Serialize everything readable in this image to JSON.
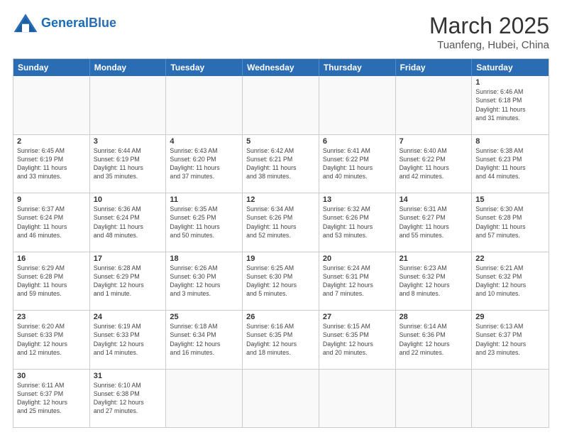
{
  "header": {
    "logo_general": "General",
    "logo_blue": "Blue",
    "month": "March 2025",
    "location": "Tuanfeng, Hubei, China"
  },
  "weekdays": [
    "Sunday",
    "Monday",
    "Tuesday",
    "Wednesday",
    "Thursday",
    "Friday",
    "Saturday"
  ],
  "rows": [
    [
      {
        "day": "",
        "info": ""
      },
      {
        "day": "",
        "info": ""
      },
      {
        "day": "",
        "info": ""
      },
      {
        "day": "",
        "info": ""
      },
      {
        "day": "",
        "info": ""
      },
      {
        "day": "",
        "info": ""
      },
      {
        "day": "1",
        "info": "Sunrise: 6:46 AM\nSunset: 6:18 PM\nDaylight: 11 hours\nand 31 minutes."
      }
    ],
    [
      {
        "day": "2",
        "info": "Sunrise: 6:45 AM\nSunset: 6:19 PM\nDaylight: 11 hours\nand 33 minutes."
      },
      {
        "day": "3",
        "info": "Sunrise: 6:44 AM\nSunset: 6:19 PM\nDaylight: 11 hours\nand 35 minutes."
      },
      {
        "day": "4",
        "info": "Sunrise: 6:43 AM\nSunset: 6:20 PM\nDaylight: 11 hours\nand 37 minutes."
      },
      {
        "day": "5",
        "info": "Sunrise: 6:42 AM\nSunset: 6:21 PM\nDaylight: 11 hours\nand 38 minutes."
      },
      {
        "day": "6",
        "info": "Sunrise: 6:41 AM\nSunset: 6:22 PM\nDaylight: 11 hours\nand 40 minutes."
      },
      {
        "day": "7",
        "info": "Sunrise: 6:40 AM\nSunset: 6:22 PM\nDaylight: 11 hours\nand 42 minutes."
      },
      {
        "day": "8",
        "info": "Sunrise: 6:38 AM\nSunset: 6:23 PM\nDaylight: 11 hours\nand 44 minutes."
      }
    ],
    [
      {
        "day": "9",
        "info": "Sunrise: 6:37 AM\nSunset: 6:24 PM\nDaylight: 11 hours\nand 46 minutes."
      },
      {
        "day": "10",
        "info": "Sunrise: 6:36 AM\nSunset: 6:24 PM\nDaylight: 11 hours\nand 48 minutes."
      },
      {
        "day": "11",
        "info": "Sunrise: 6:35 AM\nSunset: 6:25 PM\nDaylight: 11 hours\nand 50 minutes."
      },
      {
        "day": "12",
        "info": "Sunrise: 6:34 AM\nSunset: 6:26 PM\nDaylight: 11 hours\nand 52 minutes."
      },
      {
        "day": "13",
        "info": "Sunrise: 6:32 AM\nSunset: 6:26 PM\nDaylight: 11 hours\nand 53 minutes."
      },
      {
        "day": "14",
        "info": "Sunrise: 6:31 AM\nSunset: 6:27 PM\nDaylight: 11 hours\nand 55 minutes."
      },
      {
        "day": "15",
        "info": "Sunrise: 6:30 AM\nSunset: 6:28 PM\nDaylight: 11 hours\nand 57 minutes."
      }
    ],
    [
      {
        "day": "16",
        "info": "Sunrise: 6:29 AM\nSunset: 6:28 PM\nDaylight: 11 hours\nand 59 minutes."
      },
      {
        "day": "17",
        "info": "Sunrise: 6:28 AM\nSunset: 6:29 PM\nDaylight: 12 hours\nand 1 minute."
      },
      {
        "day": "18",
        "info": "Sunrise: 6:26 AM\nSunset: 6:30 PM\nDaylight: 12 hours\nand 3 minutes."
      },
      {
        "day": "19",
        "info": "Sunrise: 6:25 AM\nSunset: 6:30 PM\nDaylight: 12 hours\nand 5 minutes."
      },
      {
        "day": "20",
        "info": "Sunrise: 6:24 AM\nSunset: 6:31 PM\nDaylight: 12 hours\nand 7 minutes."
      },
      {
        "day": "21",
        "info": "Sunrise: 6:23 AM\nSunset: 6:32 PM\nDaylight: 12 hours\nand 8 minutes."
      },
      {
        "day": "22",
        "info": "Sunrise: 6:21 AM\nSunset: 6:32 PM\nDaylight: 12 hours\nand 10 minutes."
      }
    ],
    [
      {
        "day": "23",
        "info": "Sunrise: 6:20 AM\nSunset: 6:33 PM\nDaylight: 12 hours\nand 12 minutes."
      },
      {
        "day": "24",
        "info": "Sunrise: 6:19 AM\nSunset: 6:33 PM\nDaylight: 12 hours\nand 14 minutes."
      },
      {
        "day": "25",
        "info": "Sunrise: 6:18 AM\nSunset: 6:34 PM\nDaylight: 12 hours\nand 16 minutes."
      },
      {
        "day": "26",
        "info": "Sunrise: 6:16 AM\nSunset: 6:35 PM\nDaylight: 12 hours\nand 18 minutes."
      },
      {
        "day": "27",
        "info": "Sunrise: 6:15 AM\nSunset: 6:35 PM\nDaylight: 12 hours\nand 20 minutes."
      },
      {
        "day": "28",
        "info": "Sunrise: 6:14 AM\nSunset: 6:36 PM\nDaylight: 12 hours\nand 22 minutes."
      },
      {
        "day": "29",
        "info": "Sunrise: 6:13 AM\nSunset: 6:37 PM\nDaylight: 12 hours\nand 23 minutes."
      }
    ],
    [
      {
        "day": "30",
        "info": "Sunrise: 6:11 AM\nSunset: 6:37 PM\nDaylight: 12 hours\nand 25 minutes."
      },
      {
        "day": "31",
        "info": "Sunrise: 6:10 AM\nSunset: 6:38 PM\nDaylight: 12 hours\nand 27 minutes."
      },
      {
        "day": "",
        "info": ""
      },
      {
        "day": "",
        "info": ""
      },
      {
        "day": "",
        "info": ""
      },
      {
        "day": "",
        "info": ""
      },
      {
        "day": "",
        "info": ""
      }
    ]
  ]
}
